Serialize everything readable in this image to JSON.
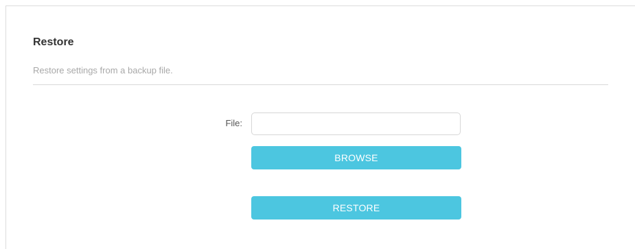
{
  "restore_section": {
    "title": "Restore",
    "description": "Restore settings from a backup file.",
    "file_label": "File:",
    "file_value": "",
    "browse_label": "BROWSE",
    "restore_label": "RESTORE"
  },
  "colors": {
    "button_background": "#4cc6e0",
    "button_text": "#ffffff",
    "title_text": "#333333",
    "description_text": "#a8a8a8",
    "divider": "#d9d9d9"
  }
}
